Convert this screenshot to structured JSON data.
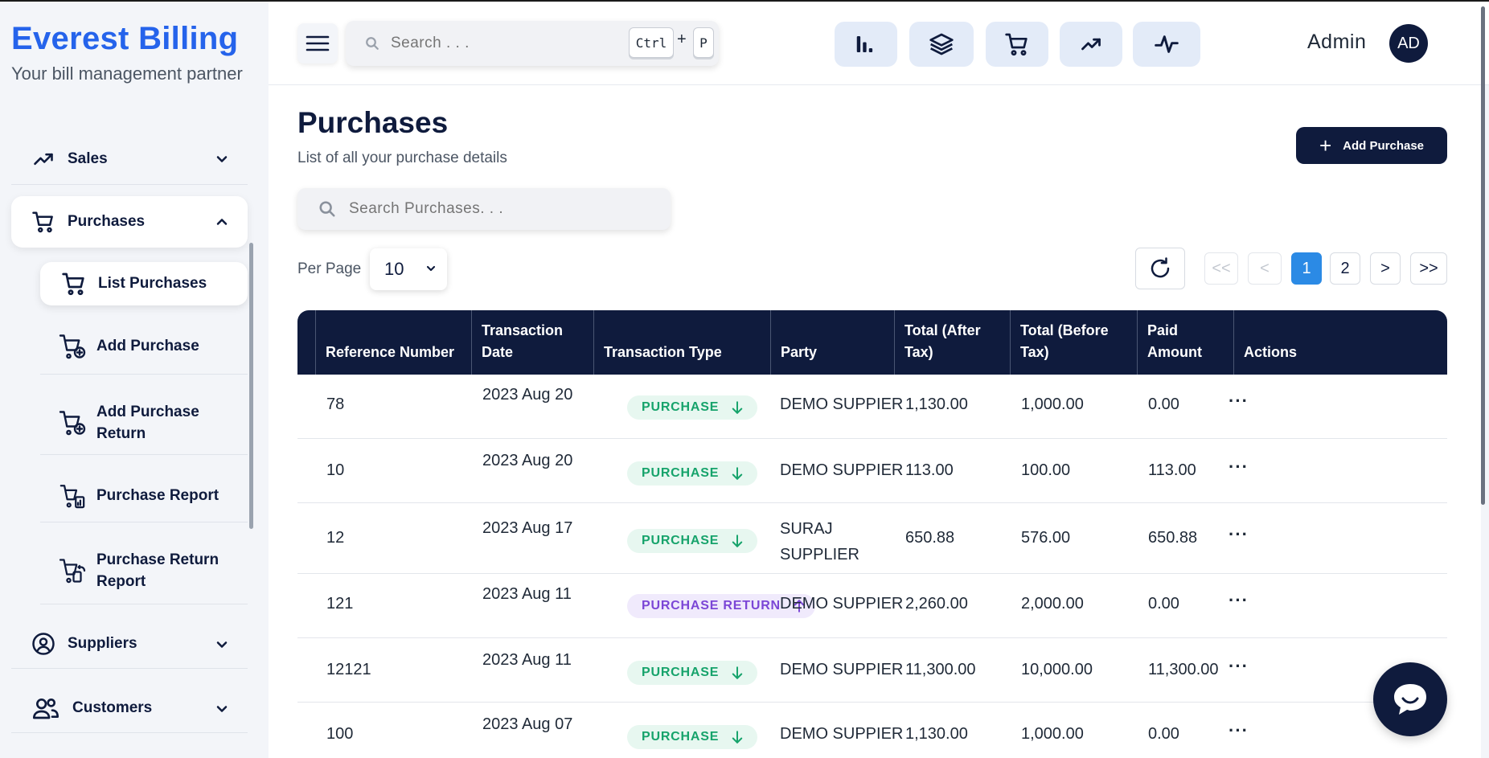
{
  "brand": {
    "title": "Everest Billing",
    "subtitle": "Your bill management partner"
  },
  "sidebar": {
    "items": [
      {
        "label": "Sales",
        "icon": "trending-up-icon",
        "expanded": false
      },
      {
        "label": "Purchases",
        "icon": "cart-icon",
        "expanded": true
      },
      {
        "label": "Suppliers",
        "icon": "user-circle-icon",
        "expanded": false
      },
      {
        "label": "Customers",
        "icon": "users-icon",
        "expanded": false
      }
    ],
    "purchase_sub": [
      {
        "label": "List Purchases",
        "active": true
      },
      {
        "label": "Add Purchase"
      },
      {
        "label": "Add Purchase Return"
      },
      {
        "label": "Purchase Report"
      },
      {
        "label": "Purchase Return Report"
      }
    ]
  },
  "topbar": {
    "search_placeholder": "Search . . .",
    "shortcut_key1": "Ctrl",
    "shortcut_plus": "+",
    "shortcut_key2": "P",
    "quick_icons": [
      "bar-chart-icon",
      "layers-icon",
      "cart-icon",
      "trending-up-icon",
      "activity-icon"
    ],
    "user_label": "Admin",
    "avatar_initials": "AD"
  },
  "page": {
    "title": "Purchases",
    "subtitle": "List of all your purchase details",
    "add_button": "Add Purchase",
    "search_placeholder": "Search Purchases. . .",
    "per_page_label": "Per Page",
    "per_page_value": "10",
    "pagination": {
      "first": "<<",
      "prev": "<",
      "page1": "1",
      "page2": "2",
      "next": ">",
      "last": ">>",
      "current": 1
    }
  },
  "table": {
    "headers": [
      "Reference Number",
      "Transaction Date",
      "Transaction Type",
      "Party",
      "Total (After Tax)",
      "Total (Before Tax)",
      "Paid Amount",
      "Actions"
    ],
    "rows": [
      {
        "ref": "78",
        "date": "2023 Aug 20",
        "type": "PURCHASE",
        "party": "DEMO SUPPIER",
        "after": "1,130.00",
        "before": "1,000.00",
        "paid": "0.00",
        "actions": "···"
      },
      {
        "ref": "10",
        "date": "2023 Aug 20",
        "type": "PURCHASE",
        "party": "DEMO SUPPIER",
        "after": "113.00",
        "before": "100.00",
        "paid": "113.00",
        "actions": "···"
      },
      {
        "ref": "12",
        "date": "2023 Aug 17",
        "type": "PURCHASE",
        "party": "SURAJ SUPPLIER",
        "after": "650.88",
        "before": "576.00",
        "paid": "650.88",
        "actions": "···"
      },
      {
        "ref": "121",
        "date": "2023 Aug 11",
        "type": "PURCHASE RETURN",
        "party": "DEMO SUPPIER",
        "after": "2,260.00",
        "before": "2,000.00",
        "paid": "0.00",
        "actions": "···"
      },
      {
        "ref": "12121",
        "date": "2023 Aug 11",
        "type": "PURCHASE",
        "party": "DEMO SUPPIER",
        "after": "11,300.00",
        "before": "10,000.00",
        "paid": "11,300.00",
        "actions": "···"
      },
      {
        "ref": "100",
        "date": "2023 Aug 07",
        "type": "PURCHASE",
        "party": "DEMO SUPPIER",
        "after": "1,130.00",
        "before": "1,000.00",
        "paid": "0.00",
        "actions": "···"
      }
    ]
  },
  "colors": {
    "brand": "#2563eb",
    "navy": "#0f1b3d",
    "purchase_green": "#16a36b",
    "return_purple": "#7b46d6",
    "page_active": "#2b8ae5"
  }
}
